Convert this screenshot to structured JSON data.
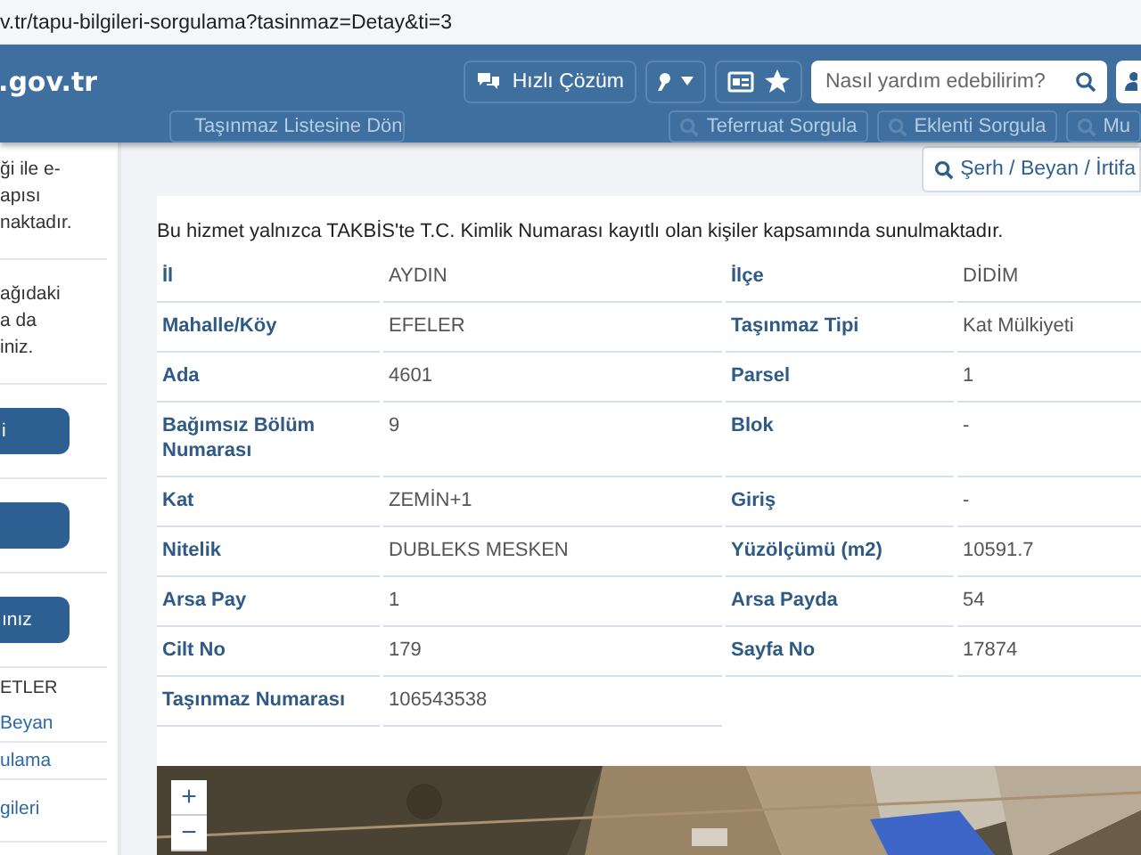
{
  "address_bar": {
    "url": "v.tr/tapu-bilgileri-sorgulama?tasinmaz=Detay&ti=3"
  },
  "header": {
    "logo": ".gov.tr",
    "quick_button": "Hızlı Çözüm",
    "search": {
      "placeholder": "Nasıl yardım edebilirim?"
    }
  },
  "toolbar": {
    "back_button": "Taşınmaz Listesine Dön",
    "buttons": [
      "Teferruat Sorgula",
      "Eklenti Sorgula",
      "Mu"
    ],
    "serh_button": "Şerh / Beyan / İrtifa"
  },
  "sidebar": {
    "items": [
      {
        "kind": "text",
        "lines": [
          "ği ile e-",
          "apısı",
          "naktadır."
        ]
      },
      {
        "kind": "text",
        "lines": [
          "ağıdaki",
          "a da",
          "iniz."
        ]
      },
      {
        "kind": "button",
        "label": "i"
      },
      {
        "kind": "button"
      },
      {
        "kind": "button",
        "label": "ınız"
      },
      {
        "kind": "heading",
        "label": "ETLER"
      },
      {
        "kind": "link",
        "label": "Beyan"
      },
      {
        "kind": "link",
        "label": "ulama"
      },
      {
        "kind": "link",
        "label": "gileri"
      }
    ]
  },
  "notice": "Bu hizmet yalnızca TAKBİS'te T.C. Kimlik Numarası kayıtlı olan kişiler kapsamında sunulmaktadır.",
  "fields": [
    {
      "label": "İl",
      "value": "AYDIN"
    },
    {
      "label": "İlçe",
      "value": "DİDİM"
    },
    {
      "label": "Mahalle/Köy",
      "value": "EFELER"
    },
    {
      "label": "Taşınmaz Tipi",
      "value": "Kat Mülkiyeti"
    },
    {
      "label": "Ada",
      "value": "4601"
    },
    {
      "label": "Parsel",
      "value": "1"
    },
    {
      "label": "Bağımsız Bölüm Numarası",
      "value": "9"
    },
    {
      "label": "Blok",
      "value": "-"
    },
    {
      "label": "Kat",
      "value": "ZEMİN+1"
    },
    {
      "label": "Giriş",
      "value": "-"
    },
    {
      "label": "Nitelik",
      "value": "DUBLEKS MESKEN"
    },
    {
      "label": "Yüzölçümü (m2)",
      "value": "10591.7"
    },
    {
      "label": "Arsa Pay",
      "value": "1"
    },
    {
      "label": "Arsa Payda",
      "value": "54"
    },
    {
      "label": "Cilt No",
      "value": "179"
    },
    {
      "label": "Sayfa No",
      "value": "17874"
    },
    {
      "label": "Taşınmaz Numarası",
      "value": "106543538"
    }
  ],
  "map": {
    "kind": "picture",
    "zoom_in": "+",
    "zoom_out": "−"
  }
}
